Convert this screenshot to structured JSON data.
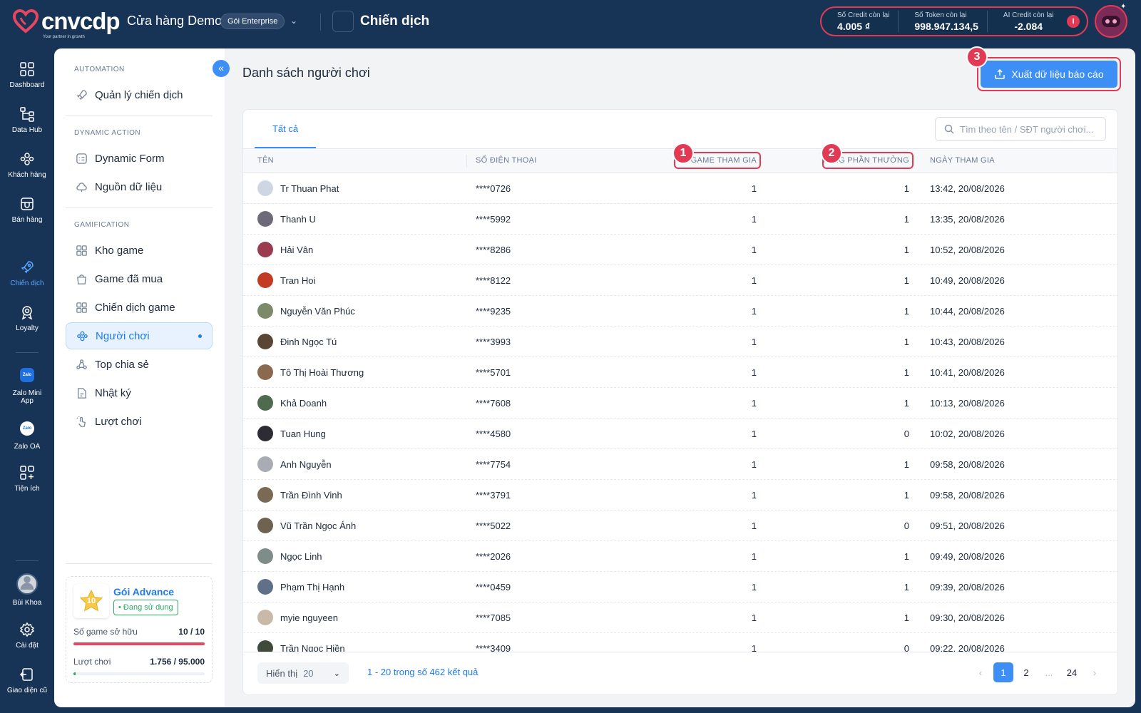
{
  "topbar": {
    "brand": "cnvcdp",
    "tagline": "Your partner in growth",
    "store_name": "Cửa hàng Demo",
    "plan_badge": "Gói Enterprise",
    "section_title": "Chiến dịch",
    "credits": [
      {
        "label": "Số Credit còn lại",
        "value": "4.005 ₫"
      },
      {
        "label": "Số Token còn lại",
        "value": "998.947.134,5"
      },
      {
        "label": "AI Credit còn lại",
        "value": "-2.084"
      }
    ],
    "info_icon": "i"
  },
  "rail": {
    "items": [
      {
        "label": "Dashboard",
        "icon": "grid-icon"
      },
      {
        "label": "Data Hub",
        "icon": "hierarchy-icon"
      },
      {
        "label": "Khách hàng",
        "icon": "users-icon"
      },
      {
        "label": "Bán hàng",
        "icon": "store-icon"
      },
      {
        "label": "Chiến dịch",
        "icon": "rocket-icon"
      },
      {
        "label": "Loyalty",
        "icon": "medal-icon"
      },
      {
        "label": "Zalo Mini App",
        "icon": "zalo-icon"
      },
      {
        "label": "Zalo OA",
        "icon": "zalo-oa-icon"
      },
      {
        "label": "Tiện ích",
        "icon": "apps-add-icon"
      },
      {
        "label": "Bùi Khoa",
        "icon": "user-avatar"
      },
      {
        "label": "Cài đặt",
        "icon": "gear-icon"
      },
      {
        "label": "Giao diện cũ",
        "icon": "back-icon"
      }
    ],
    "zalo_badge": "Zalo"
  },
  "sidebar": {
    "sections": [
      {
        "title": "AUTOMATION",
        "items": [
          "Quản lý chiến dịch"
        ]
      },
      {
        "title": "DYNAMIC ACTION",
        "items": [
          "Dynamic Form",
          "Nguồn dữ liệu"
        ]
      },
      {
        "title": "GAMIFICATION",
        "items": [
          "Kho game",
          "Game đã mua",
          "Chiến dịch game",
          "Người chơi",
          "Top chia sẻ",
          "Nhật ký",
          "Lượt chơi"
        ]
      }
    ],
    "plan": {
      "level": "10",
      "name": "Gói Advance",
      "status": "• Đang sử dụng",
      "games_label": "Số game sở hữu",
      "games_value": "10 / 10",
      "games_fraction": 1.0,
      "plays_label": "Lượt chơi",
      "plays_value": "1.756 / 95.000",
      "plays_fraction": 0.018
    }
  },
  "main": {
    "title": "Danh sách người chơi",
    "export_label": "Xuất dữ liệu báo cáo",
    "tab_all": "Tất cả",
    "search_placeholder": "Tìm theo tên / SĐT người chơi...",
    "annotations": [
      "1",
      "2",
      "3"
    ],
    "columns": [
      "TÊN",
      "SỐ ĐIỆN THOẠI",
      "SỐ GAME THAM GIA",
      "TỔNG PHẦN THƯỞNG",
      "NGÀY THAM GIA"
    ],
    "rows": [
      {
        "name": "Tr Thuan Phat",
        "phone": "****0726",
        "games": "1",
        "rewards": "1",
        "joined": "13:42, 20/08/2026",
        "color": "#cfd6e3"
      },
      {
        "name": "Thanh U",
        "phone": "****5992",
        "games": "1",
        "rewards": "1",
        "joined": "13:35, 20/08/2026",
        "color": "#6f6a7a"
      },
      {
        "name": "Hải Vân",
        "phone": "****8286",
        "games": "1",
        "rewards": "1",
        "joined": "10:52, 20/08/2026",
        "color": "#9a3b4e"
      },
      {
        "name": "Tran Hoi",
        "phone": "****8122",
        "games": "1",
        "rewards": "1",
        "joined": "10:49, 20/08/2026",
        "color": "#c23b22"
      },
      {
        "name": "Nguyễn Văn Phúc",
        "phone": "****9235",
        "games": "1",
        "rewards": "1",
        "joined": "10:44, 20/08/2026",
        "color": "#7d8a6a"
      },
      {
        "name": "Đinh Ngọc Tú",
        "phone": "****3993",
        "games": "1",
        "rewards": "1",
        "joined": "10:43, 20/08/2026",
        "color": "#5a4634"
      },
      {
        "name": "Tô Thị Hoài Thương",
        "phone": "****5701",
        "games": "1",
        "rewards": "1",
        "joined": "10:41, 20/08/2026",
        "color": "#8a6a4e"
      },
      {
        "name": "Khả Doanh",
        "phone": "****7608",
        "games": "1",
        "rewards": "1",
        "joined": "10:13, 20/08/2026",
        "color": "#4e6b4f"
      },
      {
        "name": "Tuan Hung",
        "phone": "****4580",
        "games": "1",
        "rewards": "0",
        "joined": "10:02, 20/08/2026",
        "color": "#2d2b33"
      },
      {
        "name": "Anh Nguyễn",
        "phone": "****7754",
        "games": "1",
        "rewards": "1",
        "joined": "09:58, 20/08/2026",
        "color": "#a9acb3"
      },
      {
        "name": "Trần Đình Vinh",
        "phone": "****3791",
        "games": "1",
        "rewards": "1",
        "joined": "09:58, 20/08/2026",
        "color": "#7a6a55"
      },
      {
        "name": "Vũ Trần Ngọc Ánh",
        "phone": "****5022",
        "games": "1",
        "rewards": "0",
        "joined": "09:51, 20/08/2026",
        "color": "#6d6350"
      },
      {
        "name": "Ngọc Linh",
        "phone": "****2026",
        "games": "1",
        "rewards": "1",
        "joined": "09:49, 20/08/2026",
        "color": "#7e8d8a"
      },
      {
        "name": "Phạm Thị Hạnh",
        "phone": "****0459",
        "games": "1",
        "rewards": "1",
        "joined": "09:39, 20/08/2026",
        "color": "#5f7088"
      },
      {
        "name": "myie nguyeen",
        "phone": "****7085",
        "games": "1",
        "rewards": "1",
        "joined": "09:30, 20/08/2026",
        "color": "#c9b9a8"
      },
      {
        "name": "Trần Ngọc Hiền",
        "phone": "****3409",
        "games": "1",
        "rewards": "0",
        "joined": "09:22, 20/08/2026",
        "color": "#3f4a3a"
      }
    ],
    "footer": {
      "show_label": "Hiển thị",
      "page_size": "20",
      "range_text": "1 - 20 trong số 462 kết quả",
      "pages": [
        "1",
        "2",
        "...",
        "24"
      ]
    }
  }
}
